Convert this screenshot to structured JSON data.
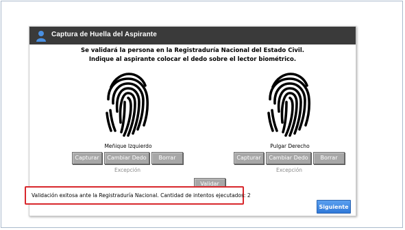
{
  "dialog": {
    "title": "Captura de Huella del Aspirante"
  },
  "instructions": {
    "line1": "Se validará la persona en la Registraduría Nacional del Estado Civil.",
    "line2": "Indique al aspirante colocar el dedo sobre el lector biométrico."
  },
  "left_finger": {
    "label": "Meñique Izquierdo",
    "capture_label": "Capturar",
    "change_label": "Cambiar Dedo",
    "clear_label": "Borrar",
    "exception_label": "Excepción"
  },
  "right_finger": {
    "label": "Pulgar Derecho",
    "capture_label": "Capturar",
    "change_label": "Cambiar Dedo",
    "clear_label": "Borrar",
    "exception_label": "Excepción"
  },
  "validate_label": "Validar",
  "status": {
    "message": "Validación exitosa ante la Registraduría Nacional. Cantidad de intentos ejecutados: 2"
  },
  "next_label": "Siguiente",
  "colors": {
    "titlebar": "#3a3a3a",
    "button_gray": "#a7a7a7",
    "highlight_red": "#d8262b",
    "next_blue": "#2f78d8"
  }
}
